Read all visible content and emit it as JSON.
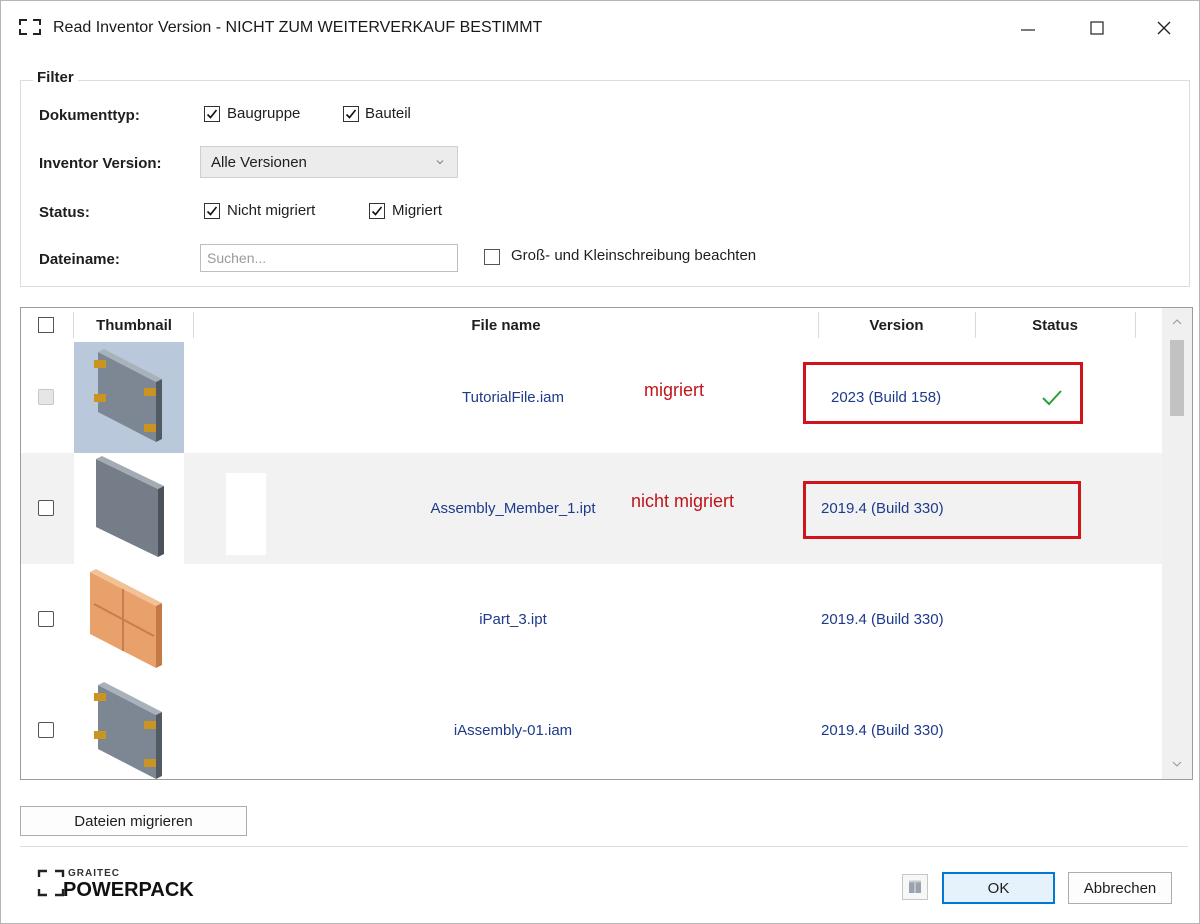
{
  "window": {
    "title": "Read Inventor Version - NICHT ZUM WEITERVERKAUF BESTIMMT"
  },
  "filter": {
    "legend": "Filter",
    "doctype_label": "Dokumenttyp:",
    "doctype_options": [
      {
        "label": "Baugruppe",
        "checked": true
      },
      {
        "label": "Bauteil",
        "checked": true
      }
    ],
    "version_label": "Inventor Version:",
    "version_selected": "Alle Versionen",
    "status_label": "Status:",
    "status_options": [
      {
        "label": "Nicht migriert",
        "checked": true
      },
      {
        "label": "Migriert",
        "checked": true
      }
    ],
    "filename_label": "Dateiname:",
    "filename_value": "",
    "filename_placeholder": "Suchen...",
    "case_label": "Groß- und Kleinschreibung beachten",
    "case_checked": false
  },
  "grid": {
    "columns": [
      "Thumbnail",
      "File name",
      "Version",
      "Status"
    ],
    "rows": [
      {
        "file": "TutorialFile.iam",
        "version": "2023 (Build 158)",
        "status": "check",
        "checked": false,
        "disabled": true
      },
      {
        "file": "Assembly_Member_1.ipt",
        "version": "2019.4 (Build 330)",
        "status": "",
        "checked": false,
        "disabled": false
      },
      {
        "file": "iPart_3.ipt",
        "version": "2019.4 (Build 330)",
        "status": "",
        "checked": false,
        "disabled": false
      },
      {
        "file": "iAssembly-01.iam",
        "version": "2019.4 (Build 330)",
        "status": "",
        "checked": false,
        "disabled": false
      }
    ]
  },
  "annotations": {
    "row1": "migriert",
    "row2": "nicht migriert"
  },
  "actions": {
    "migrate": "Dateien migrieren",
    "ok": "OK",
    "cancel": "Abbrechen"
  },
  "branding": {
    "line1": "GRAITEC",
    "line2": "POWERPACK"
  },
  "colors": {
    "annotation_red": "#d0141b",
    "check_green": "#2e9e3a",
    "link_blue": "#1e3a8a"
  }
}
